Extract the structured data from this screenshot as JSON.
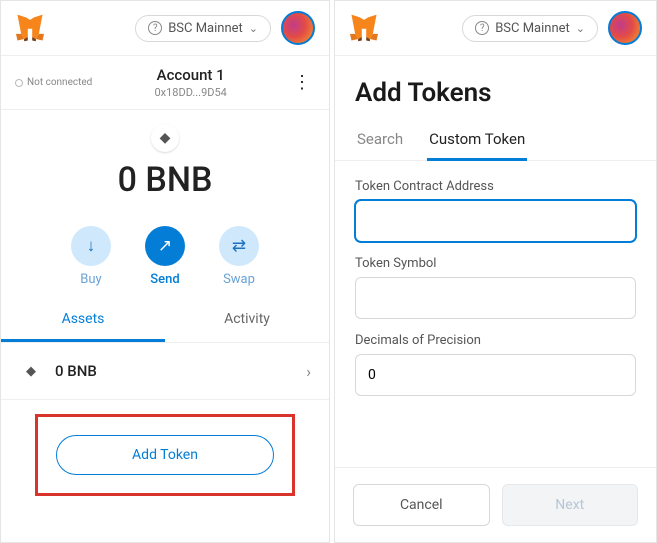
{
  "left": {
    "network_label": "BSC Mainnet",
    "connection_status": "Not connected",
    "account_name": "Account 1",
    "account_address": "0x18DD...9D54",
    "balance_text": "0 BNB",
    "actions": {
      "buy": "Buy",
      "send": "Send",
      "swap": "Swap"
    },
    "tabs": {
      "assets": "Assets",
      "activity": "Activity"
    },
    "asset_row_label": "0 BNB",
    "add_token_label": "Add Token"
  },
  "right": {
    "network_label": "BSC Mainnet",
    "title": "Add Tokens",
    "tabs": {
      "search": "Search",
      "custom": "Custom Token"
    },
    "form": {
      "address_label": "Token Contract Address",
      "address_value": "",
      "symbol_label": "Token Symbol",
      "symbol_value": "",
      "decimals_label": "Decimals of Precision",
      "decimals_value": "0"
    },
    "footer": {
      "cancel": "Cancel",
      "next": "Next"
    }
  }
}
